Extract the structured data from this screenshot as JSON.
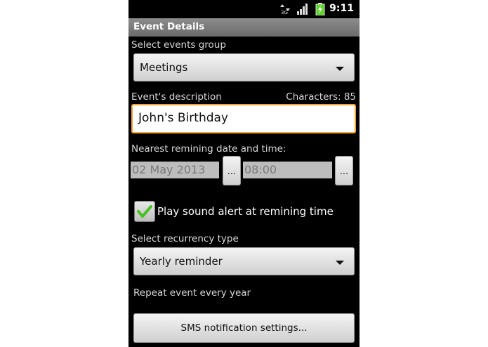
{
  "status_bar": {
    "time": "9:11",
    "icons": [
      "data-arrows-icon",
      "signal-icon",
      "battery-charging-icon"
    ]
  },
  "title_bar": {
    "title": "Event Details"
  },
  "form": {
    "group_label": "Select events group",
    "group_value": "Meetings",
    "description_label": "Event's description",
    "characters_counter": "Characters: 85",
    "description_value": "John's Birthday",
    "date_time_label": "Nearest remining date and time:",
    "date_value": "02 May 2013",
    "date_picker_label": "...",
    "time_value": "08:00",
    "time_picker_label": "...",
    "sound_alert_label": "Play sound alert at remining time",
    "sound_alert_checked": true,
    "recurrency_label": "Select recurrency type",
    "recurrency_value": "Yearly reminder",
    "recurrency_note": "Repeat event every year",
    "sms_button_label": "SMS notification settings..."
  },
  "colors": {
    "focus_border": "#f7a133",
    "check_green": "#46c21f",
    "battery_green": "#5fd42a"
  }
}
